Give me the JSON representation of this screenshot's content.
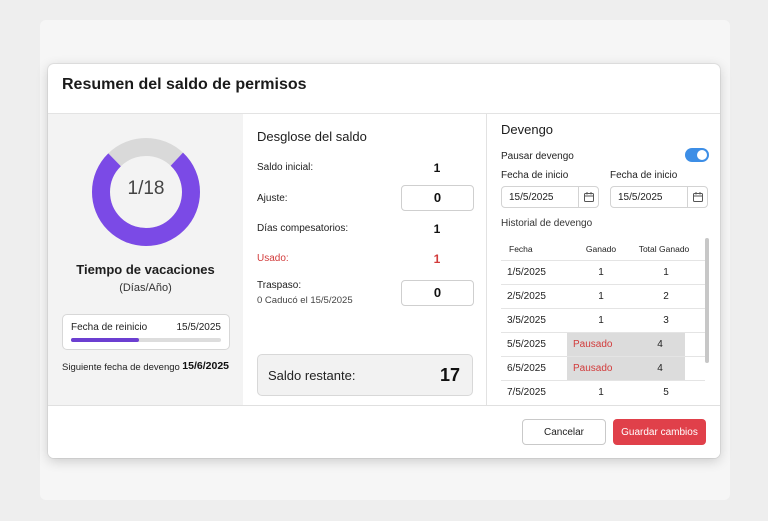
{
  "dialog": {
    "title": "Resumen del saldo de permisos"
  },
  "summary": {
    "ratio_label": "1/18",
    "used": 1,
    "total": 18,
    "title": "Tiempo de vacaciones",
    "subtitle": "(Días/Año)",
    "reset_label": "Fecha de reinicio",
    "reset_date": "15/5/2025",
    "reset_progress": 0.45,
    "next_accrual_label": "Siguiente fecha de devengo",
    "next_accrual_date": "15/6/2025",
    "colors": {
      "donut_fill": "#7b4ae6",
      "donut_track": "#d9d9d9",
      "progress": "#6c3fd1"
    }
  },
  "breakdown": {
    "title": "Desglose del saldo",
    "initial": {
      "label": "Saldo inicial:",
      "value": "1"
    },
    "adjust": {
      "label": "Ajuste:",
      "value": "0"
    },
    "comp": {
      "label": "Días compesatorios:",
      "value": "1"
    },
    "used": {
      "label": "Usado:",
      "value": "1"
    },
    "carry": {
      "label": "Traspaso:",
      "value": "0",
      "note": "0 Caducó el 15/5/2025"
    },
    "remaining": {
      "label": "Saldo restante:",
      "value": "17"
    }
  },
  "accrual": {
    "title": "Devengo",
    "pause_label": "Pausar devengo",
    "pause_on": true,
    "start1": {
      "label": "Fecha de inicio",
      "value": "15/5/2025"
    },
    "start2": {
      "label": "Fecha de inicio",
      "value": "15/5/2025"
    },
    "history_label": "Historial de devengo",
    "headers": [
      "Fecha",
      "Ganado",
      "Total Ganado"
    ],
    "rows": [
      [
        "1/5/2025",
        "1",
        "1"
      ],
      [
        "2/5/2025",
        "1",
        "2"
      ],
      [
        "3/5/2025",
        "1",
        "3"
      ],
      [
        "5/5/2025",
        "Pausado",
        "4"
      ],
      [
        "6/5/2025",
        "Pausado",
        "4"
      ],
      [
        "7/5/2025",
        "1",
        "5"
      ]
    ],
    "colors": {
      "toggle": "#3d8ee6",
      "paused_text": "#d23b3b"
    }
  },
  "footer": {
    "cancel_label": "Cancelar",
    "save_label": "Guardar cambios",
    "save_color": "#e0404a"
  }
}
